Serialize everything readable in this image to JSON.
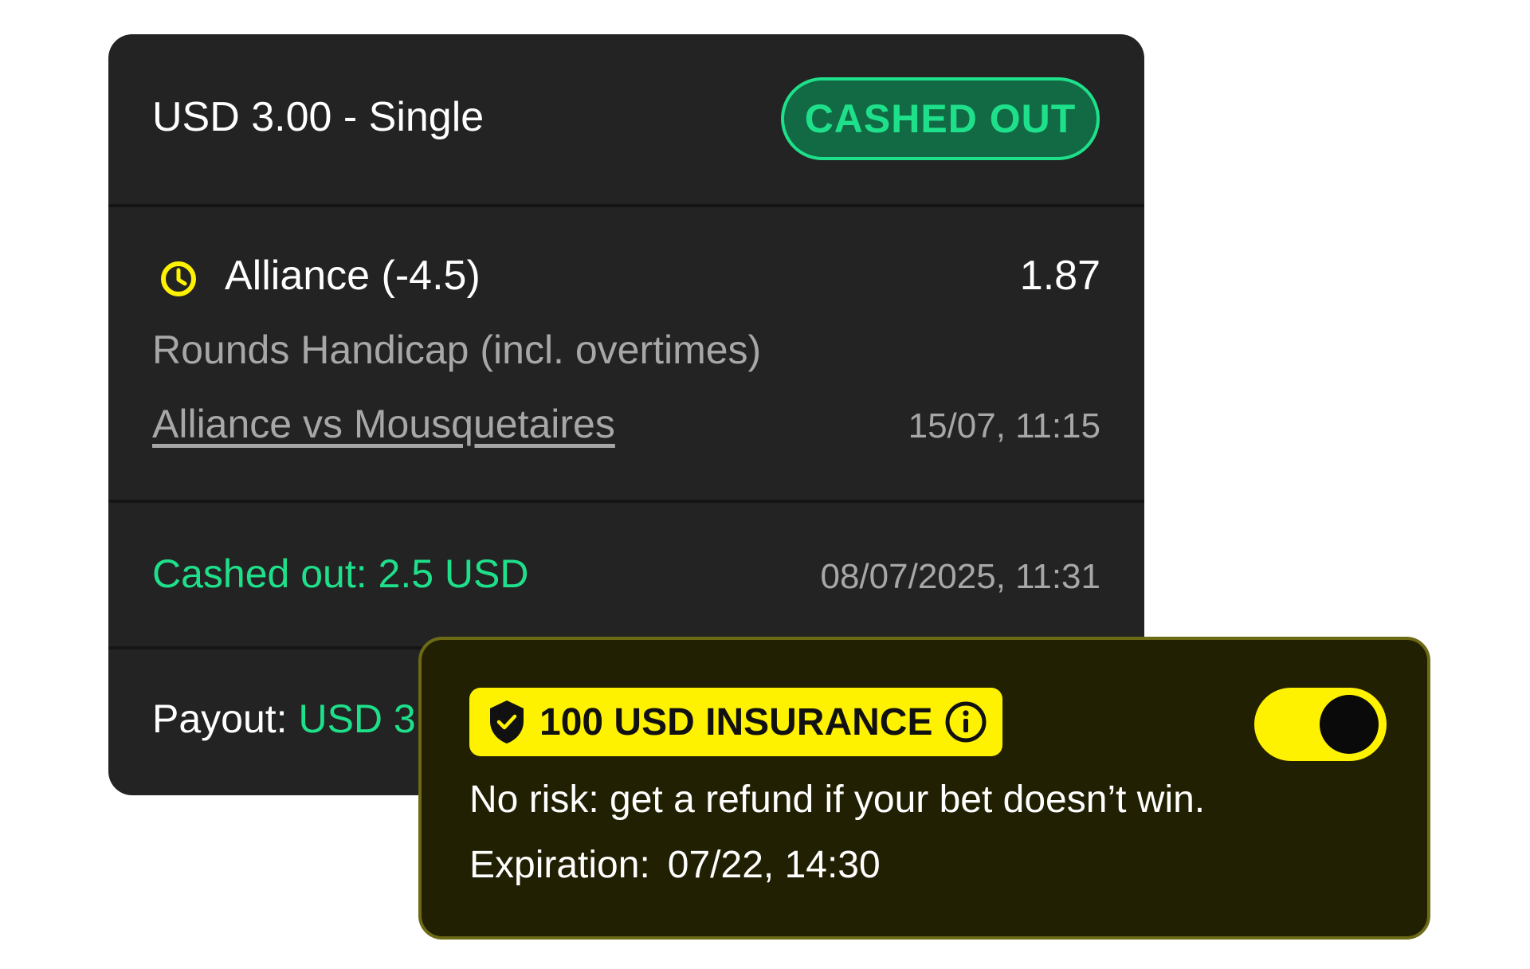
{
  "bet": {
    "header": {
      "title": "USD 3.00 - Single",
      "status": "CASHED OUT"
    },
    "selection": {
      "icon": "clock-icon",
      "name": "Alliance (-4.5)",
      "odds": "1.87",
      "market": "Rounds Handicap (incl. overtimes)",
      "event": "Alliance vs Mousquetaires",
      "event_time": "15/07, 11:15"
    },
    "cashout": {
      "label": "Cashed out: 2.5 USD",
      "time": "08/07/2025, 11:31"
    },
    "payout": {
      "label": "Payout:",
      "amount": "USD 3"
    }
  },
  "insurance": {
    "badge": "100 USD INSURANCE",
    "shield_icon": "shield-check-icon",
    "info_icon": "info-icon",
    "toggle_on": true,
    "description": "No risk: get a refund if your bet doesn’t win.",
    "expiration_label": "Expiration:",
    "expiration_value": "07/22, 14:30"
  },
  "colors": {
    "card_bg": "#232323",
    "accent_green": "#1fe08a",
    "accent_yellow": "#fff200",
    "insurance_bg": "#222002"
  }
}
